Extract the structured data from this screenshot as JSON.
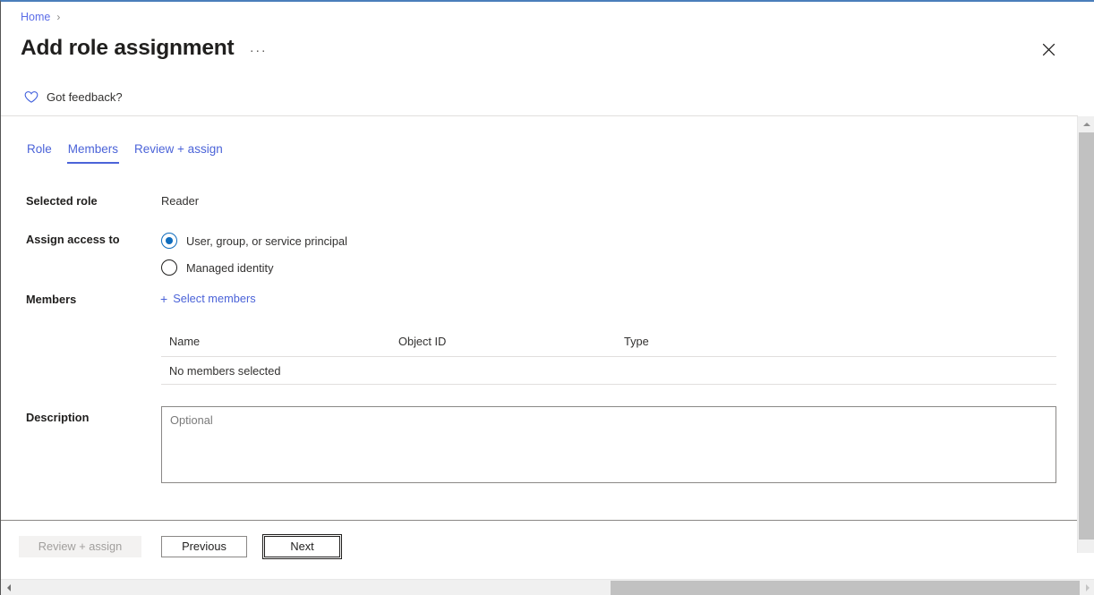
{
  "window": {
    "accent_border_color": "#4a7ebb",
    "close_icon": "close-icon"
  },
  "breadcrumb": {
    "items": [
      {
        "label": "Home",
        "separator": "›"
      }
    ]
  },
  "header": {
    "title": "Add role assignment",
    "more_menu": "···",
    "feedback_label": "Got feedback?",
    "feedback_icon": "heart-icon"
  },
  "tabs": [
    {
      "label": "Role",
      "selected": false
    },
    {
      "label": "Members",
      "selected": true
    },
    {
      "label": "Review + assign",
      "selected": false
    }
  ],
  "form": {
    "selected_role": {
      "label": "Selected role",
      "value": "Reader"
    },
    "assign_access_to": {
      "label": "Assign access to",
      "options": [
        {
          "label": "User, group, or service principal",
          "checked": true
        },
        {
          "label": "Managed identity",
          "checked": false
        }
      ]
    },
    "members": {
      "label": "Members",
      "select_members_link": "Select members",
      "plus_icon": "+"
    },
    "description": {
      "label": "Description",
      "value": "",
      "placeholder": "Optional"
    }
  },
  "members_table": {
    "columns": [
      "Name",
      "Object ID",
      "Type"
    ],
    "empty_message": "No members selected",
    "rows": []
  },
  "footer": {
    "buttons": [
      {
        "label": "Review + assign",
        "state": "disabled"
      },
      {
        "label": "Previous",
        "state": "enabled"
      },
      {
        "label": "Next",
        "state": "focused"
      }
    ]
  },
  "colors": {
    "link": "#4b63d8",
    "tab_selected_underline": "#4b63d8",
    "radio_checked": "#0f6cbd",
    "disabled_button_bg": "#f3f2f1",
    "disabled_button_text": "#a19f9d",
    "divider": "#e1dfdd",
    "scrollbar_thumb": "#c1c1c1",
    "scrollbar_track": "#f0f0f0"
  }
}
